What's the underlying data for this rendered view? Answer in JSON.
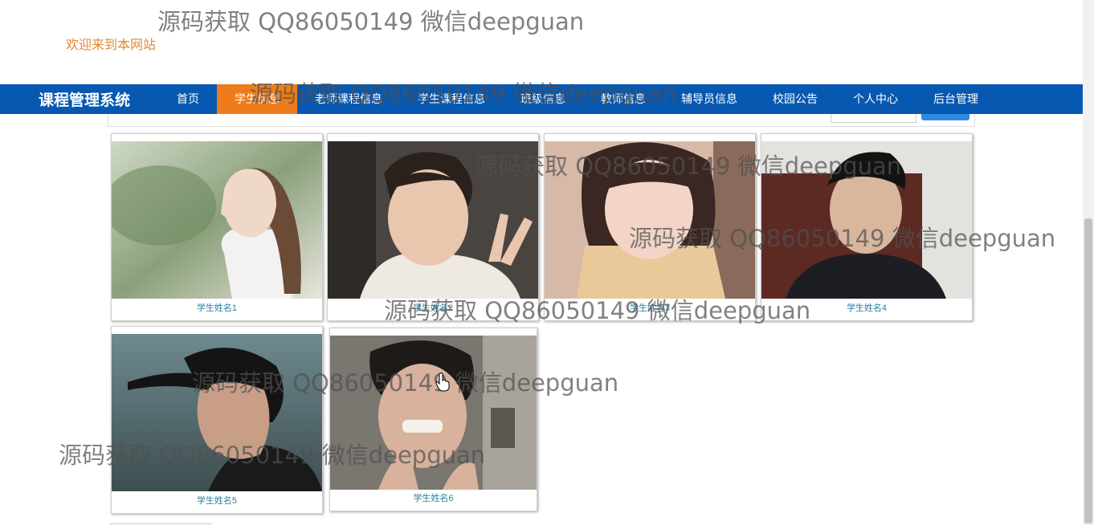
{
  "header": {
    "welcome": "欢迎来到本网站"
  },
  "nav": {
    "brand": "课程管理系统",
    "items": [
      {
        "label": "首页",
        "active": false
      },
      {
        "label": "学生信息",
        "active": true
      },
      {
        "label": "老师课程信息",
        "active": false
      },
      {
        "label": "学生课程信息",
        "active": false
      },
      {
        "label": "班级信息",
        "active": false
      },
      {
        "label": "教师信息",
        "active": false
      },
      {
        "label": "辅导员信息",
        "active": false
      },
      {
        "label": "校园公告",
        "active": false
      },
      {
        "label": "个人中心",
        "active": false
      },
      {
        "label": "后台管理",
        "active": false
      }
    ]
  },
  "students": [
    {
      "name": "学生姓名1"
    },
    {
      "name": "学生姓名2"
    },
    {
      "name": "学生姓名3"
    },
    {
      "name": "学生姓名4"
    },
    {
      "name": "学生姓名5"
    },
    {
      "name": "学生姓名6"
    }
  ],
  "watermark": "源码获取 QQ86050149 微信deepguan",
  "colors": {
    "nav_bg": "#0758b0",
    "active_bg": "#ee7c1b",
    "welcome": "#e08a2d",
    "caption": "#2a7fa0"
  }
}
